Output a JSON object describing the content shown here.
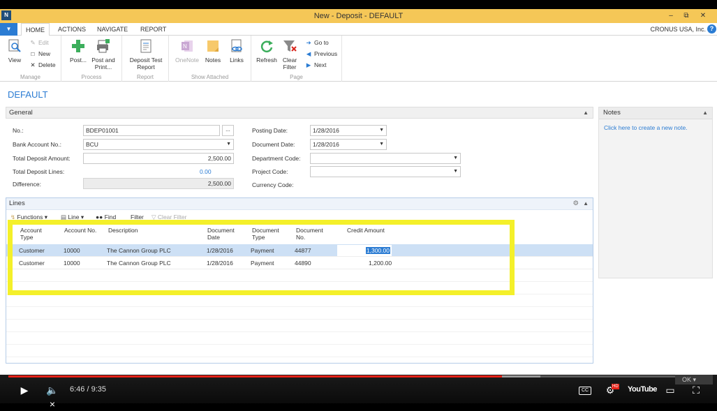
{
  "window": {
    "title": "New - Deposit - DEFAULT",
    "app_icon": "nav-app-icon",
    "minimize": "–",
    "restore": "⧉",
    "close": "✕"
  },
  "ribbon_tabs": [
    "HOME",
    "ACTIONS",
    "NAVIGATE",
    "REPORT"
  ],
  "company": "CRONUS USA, Inc.",
  "help": "?",
  "ribbon": {
    "manage": {
      "label": "Manage",
      "view": "View",
      "edit": "Edit",
      "new": "New",
      "delete": "Delete"
    },
    "process": {
      "label": "Process",
      "post": "Post...",
      "post_print_1": "Post and",
      "post_print_2": "Print..."
    },
    "report": {
      "label": "Report",
      "test_1": "Deposit Test",
      "test_2": "Report"
    },
    "show_attached": {
      "label": "Show Attached",
      "onenote": "OneNote",
      "notes": "Notes",
      "links": "Links"
    },
    "page": {
      "label": "Page",
      "refresh": "Refresh",
      "clear_filter_1": "Clear",
      "clear_filter_2": "Filter",
      "goto": "Go to",
      "previous": "Previous",
      "next": "Next"
    }
  },
  "page_title": "DEFAULT",
  "general": {
    "header": "General",
    "no_label": "No.:",
    "no_value": "BDEP01001",
    "bank_label": "Bank Account No.:",
    "bank_value": "BCU",
    "total_amount_label": "Total Deposit Amount:",
    "total_amount_value": "2,500.00",
    "total_lines_label": "Total Deposit Lines:",
    "total_lines_value": "0.00",
    "difference_label": "Difference:",
    "difference_value": "2,500.00",
    "posting_date_label": "Posting Date:",
    "posting_date_value": "1/28/2016",
    "document_date_label": "Document Date:",
    "document_date_value": "1/28/2016",
    "department_label": "Department Code:",
    "department_value": "",
    "project_label": "Project Code:",
    "project_value": "",
    "currency_label": "Currency Code:",
    "currency_value": ""
  },
  "lines": {
    "header": "Lines",
    "toolbar": {
      "functions": "Functions",
      "line": "Line",
      "find": "Find",
      "filter": "Filter",
      "clear_filter": "Clear Filter"
    },
    "columns": {
      "account_type_1": "Account",
      "account_type_2": "Type",
      "account_no": "Account No.",
      "description": "Description",
      "doc_date_1": "Document",
      "doc_date_2": "Date",
      "doc_type_1": "Document",
      "doc_type_2": "Type",
      "doc_no_1": "Document",
      "doc_no_2": "No.",
      "credit_amount": "Credit Amount"
    },
    "rows": [
      {
        "account_type": "Customer",
        "account_no": "10000",
        "description": "The Cannon Group PLC",
        "doc_date": "1/28/2016",
        "doc_type": "Payment",
        "doc_no": "44877",
        "credit": "1,300.00"
      },
      {
        "account_type": "Customer",
        "account_no": "10000",
        "description": "The Cannon Group PLC",
        "doc_date": "1/28/2016",
        "doc_type": "Payment",
        "doc_no": "44890",
        "credit": "1,200.00"
      }
    ]
  },
  "notes": {
    "header": "Notes",
    "link": "Click here to create a new note."
  },
  "player": {
    "time": "6:46 / 9:35",
    "progress": 0.705,
    "buffered": 0.76,
    "ok": "OK",
    "youtube": "YouTube",
    "cc": "CC",
    "hd": "HD"
  }
}
